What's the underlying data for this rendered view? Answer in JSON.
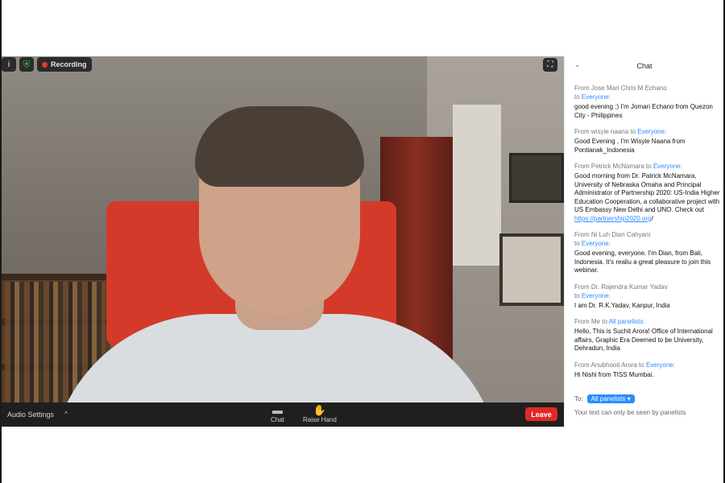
{
  "overlay": {
    "info_icon": "info-icon",
    "shield_icon": "shield-icon",
    "recording_label": "Recording",
    "fullscreen_icon": "fullscreen-icon"
  },
  "toolbar": {
    "audio_settings_label": "Audio Settings",
    "audio_caret": "^",
    "chat_label": "Chat",
    "raise_hand_label": "Raise Hand",
    "leave_label": "Leave"
  },
  "chat": {
    "title": "Chat",
    "messages": [
      {
        "from": "From Jose Mari Chris M Echano",
        "to_prefix": "to",
        "to": "Everyone",
        "text": "good evening  :) I'm Jomari Echano from Quezon City - Philippines"
      },
      {
        "from": "From wisyie naana to",
        "to_prefix": "",
        "to": "Everyone",
        "text": "Good Evening  , I'm Wisyie Naana from Pontianak_Indonesia"
      },
      {
        "from": "From Petrick McNamara to",
        "to_prefix": "",
        "to": "Everyone",
        "text": "Good morning from Dr. Patrick McNamara, University of Nebraska Omaha and Principal Administrator of Partnership 2020: US-India Higher Education Cooperation, a collaborative project with US Embassy New Delhi and UNO. Check out",
        "link": "https://partnership2020.org",
        "after": "/"
      },
      {
        "from": "From Ni Luh Dian Cahyani",
        "to_prefix": "to",
        "to": "Everyone",
        "text": "Good evening, everyone. I'm Dian, from Bali, Indonesia. It's realiu a great pleasure to join this webinar."
      },
      {
        "from": "From Dr. Rajendra Kumar Yadav",
        "to_prefix": "to",
        "to": "Everyone",
        "text": "I am Dr. R.K.Yadav, Kanpur, India"
      },
      {
        "from": "From Me to",
        "to_prefix": "",
        "to": "All panelists",
        "text": "Hello, This is Suchit Arora! Office of International affairs, Graphic Era Deemed to be University, Dehradun, India"
      },
      {
        "from": "From Anubhooti Arora to",
        "to_prefix": "",
        "to": "Everyone",
        "text": "Hi Nishi from TISS Mumbai."
      }
    ],
    "to_label": "To:",
    "recipient": "All panelists",
    "visibility_note": "Your text can only be seen by panelists"
  }
}
